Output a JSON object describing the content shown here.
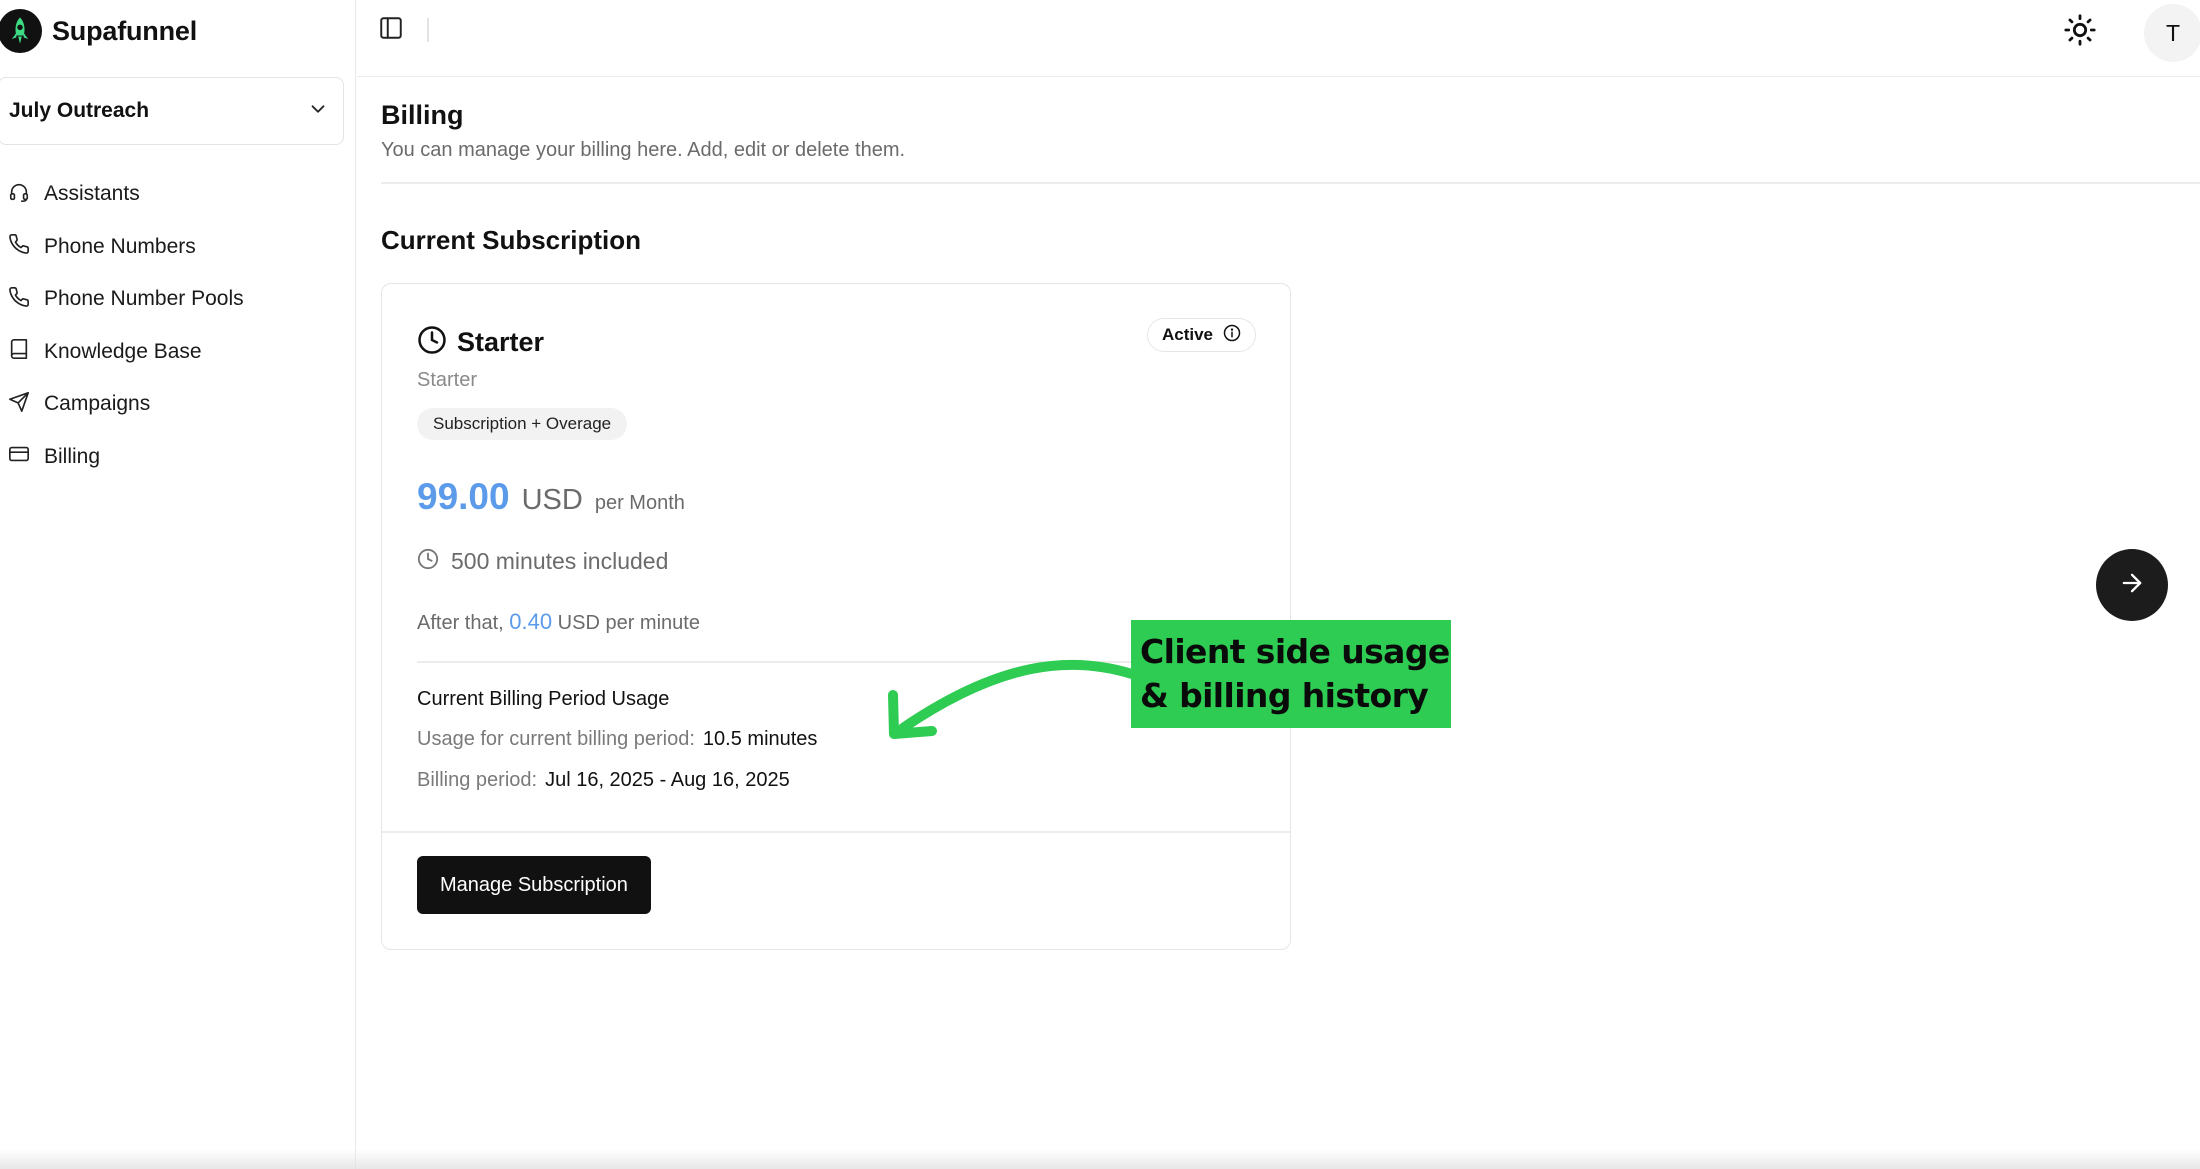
{
  "app": {
    "name": "Supafunnel",
    "logo_icon": "rocket-logo-icon"
  },
  "workspace": {
    "label": "July Outreach",
    "icon": "chevron-down-icon"
  },
  "sidebar": {
    "items": [
      {
        "label": "Assistants",
        "icon": "headset-icon"
      },
      {
        "label": "Phone Numbers",
        "icon": "phone-icon"
      },
      {
        "label": "Phone Number Pools",
        "icon": "phone-icon"
      },
      {
        "label": "Knowledge Base",
        "icon": "book-icon"
      },
      {
        "label": "Campaigns",
        "icon": "send-icon"
      },
      {
        "label": "Billing",
        "icon": "credit-card-icon"
      }
    ]
  },
  "topbar": {
    "toggle_icon": "sidebar-toggle-icon",
    "theme_icon": "sun-icon",
    "avatar_initial": "T"
  },
  "page": {
    "title": "Billing",
    "subtitle": "You can manage your billing here. Add, edit or delete them."
  },
  "subscription": {
    "section_title": "Current Subscription",
    "plan_name": "Starter",
    "plan_subtitle": "Starter",
    "status": "Active",
    "tag": "Subscription + Overage",
    "price": "99.00",
    "currency": "USD",
    "period": "per Month",
    "minutes_included": "500 minutes included",
    "overage_prefix": "After that,",
    "overage_rate": "0.40",
    "overage_suffix": "USD per minute",
    "usage_title": "Current Billing Period Usage",
    "usage_label": "Usage for current billing period:",
    "usage_value": "10.5 minutes",
    "period_label": "Billing period:",
    "period_value": "Jul 16, 2025 - Aug 16, 2025",
    "manage_label": "Manage Subscription"
  },
  "annotation": {
    "line1": "Client side usage",
    "line2": "& billing history"
  },
  "colors": {
    "accent": "#5b9bea",
    "annotation": "#2ecc52",
    "primary_button": "#111111"
  }
}
